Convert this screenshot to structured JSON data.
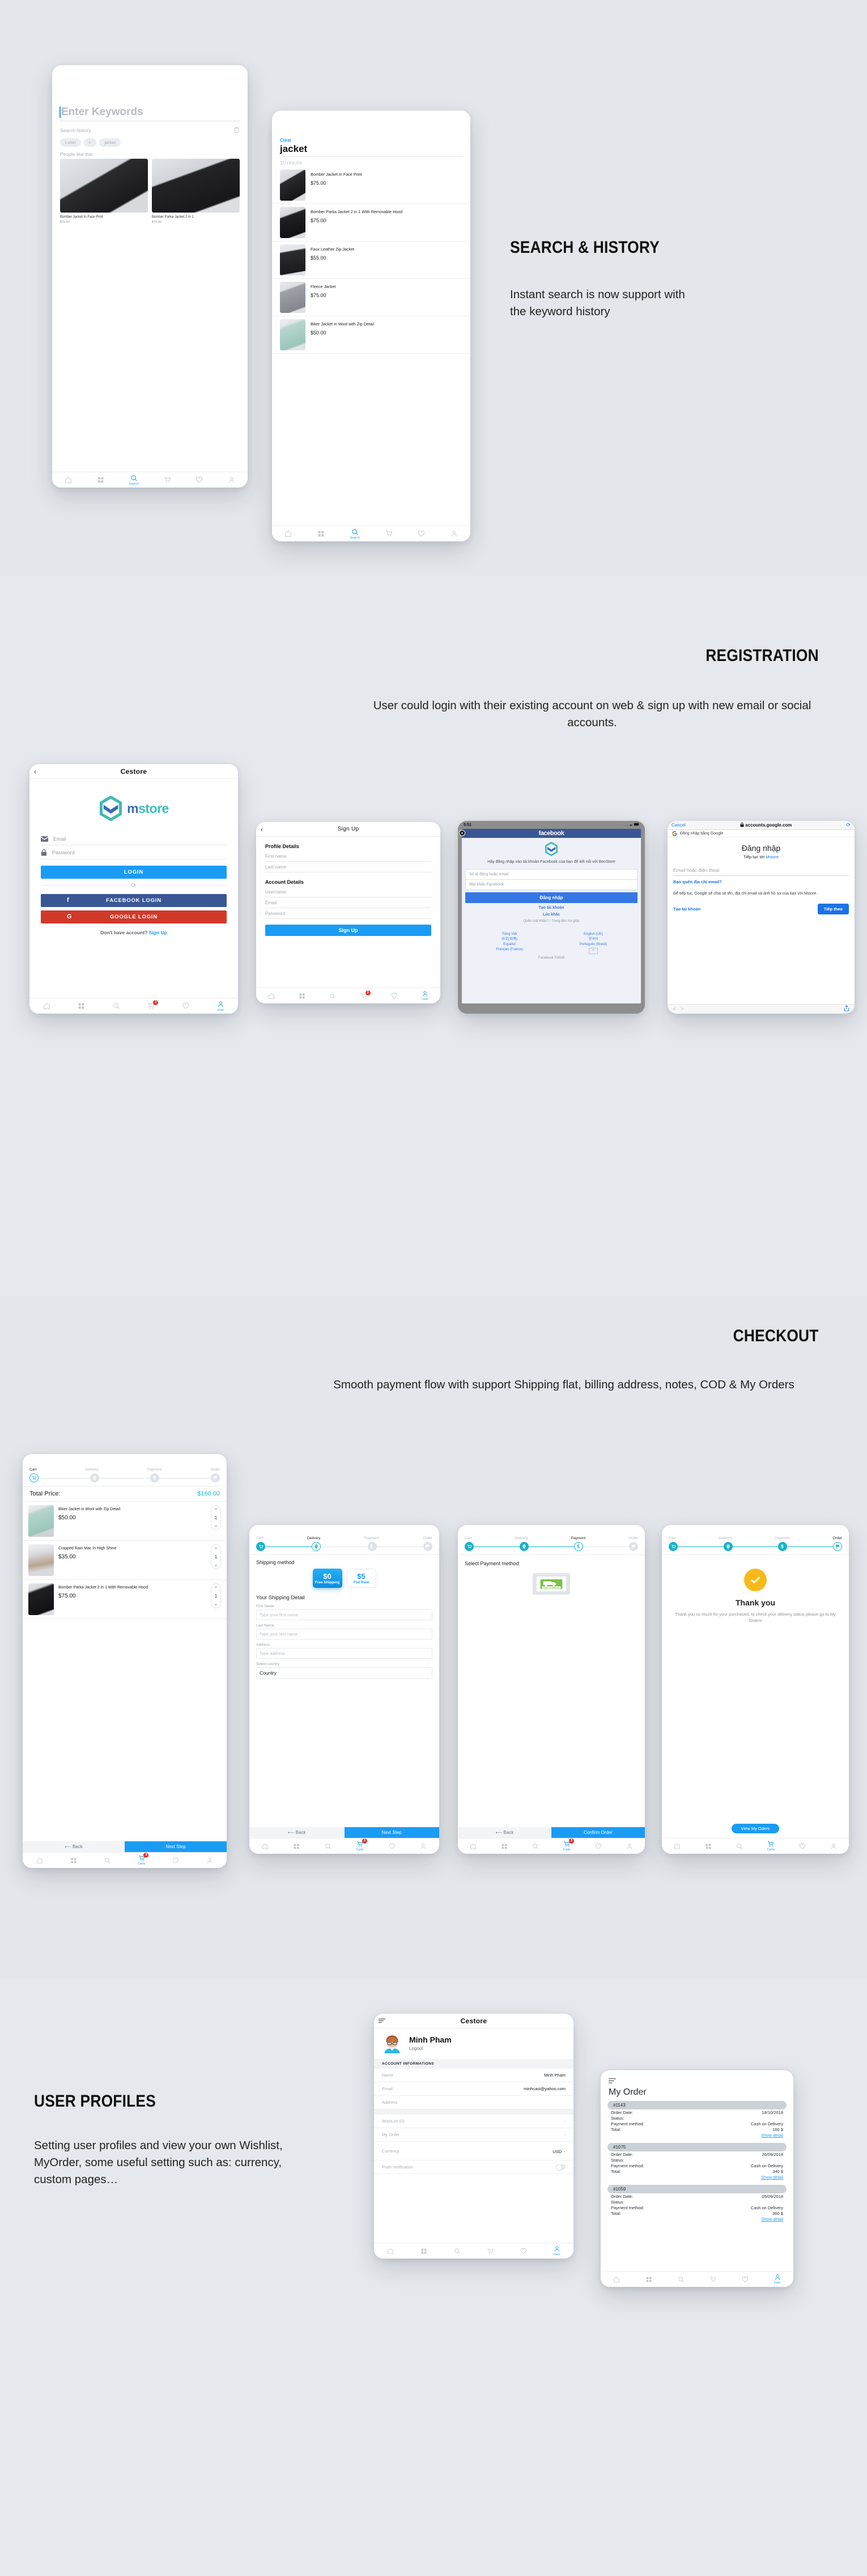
{
  "sections": {
    "search": {
      "title": "SEARCH & HISTORY",
      "body": "Instant search is now support with the keyword history"
    },
    "registration": {
      "title": "REGISTRATION",
      "body": "User could login with their existing account on web & sign up with new email or social accounts."
    },
    "checkout": {
      "title": "CHECKOUT",
      "body": "Smooth payment flow with support  Shipping flat, billing address, notes, COD & My Orders"
    },
    "profiles": {
      "title": "USER PROFILES",
      "body": "Setting user profiles and view your own Wishlist, MyOrder, some useful setting such as: currency, custom pages…"
    }
  },
  "search_empty": {
    "placeholder": "Enter Keywords",
    "history_label": "Search history",
    "trash_icon": "trash-icon",
    "chips": [
      "t-shirt",
      "t-",
      "jacket"
    ],
    "people_label": "People like this",
    "products": [
      {
        "name": "Bomber Jacket In Face Print",
        "price": "$75.00"
      },
      {
        "name": "Bomber Parka Jacket 2 in 1",
        "price": "$75.00"
      }
    ],
    "tab_label": "Search"
  },
  "search_results": {
    "clear": "Clear",
    "query": "jacket",
    "count": "10 results",
    "items": [
      {
        "name": "Bomber Jacket In Face Print",
        "price": "$75.00"
      },
      {
        "name": "Bomber Parka Jacket 2 in 1 With Removable Hood",
        "price": "$75.00"
      },
      {
        "name": "Faux Leather Zip Jacket",
        "price": "$55.00"
      },
      {
        "name": "Fleece Jacket",
        "price": "$75.00"
      },
      {
        "name": "Biker Jacket in Wool with Zip Detail",
        "price": "$50.00"
      }
    ],
    "tab_label": "Search"
  },
  "login": {
    "nav_title": "Cestore",
    "back_icon": "chevron-left-icon",
    "brand": {
      "m": "m",
      "store": "store"
    },
    "email_placeholder": "Email",
    "password_placeholder": "Password",
    "login_button": "LOGIN",
    "or": "Or",
    "facebook_button": "FACEBOOK LOGIN",
    "google_button": "GOOGLE LOGIN",
    "no_account": "Don't have account?",
    "signup_link": "Sign Up",
    "cart_badge": "3",
    "user_tab_label": "User"
  },
  "signup": {
    "nav_title": "Sign Up",
    "profile_heading": "Profile Details",
    "first_name": "First name",
    "last_name": "Last name",
    "account_heading": "Account Details",
    "username": "Username",
    "email": "Email",
    "password": "Password",
    "submit": "Sign Up",
    "cart_badge": "3",
    "user_tab_label": "User"
  },
  "facebook": {
    "status_time": "5:51",
    "brand": "facebook",
    "close_icon": "close-icon",
    "desc": "Hãy đăng nhập vào tài khoản Facebook của bạn để kết nối với BeoStore",
    "email_placeholder": "Số di động hoặc email",
    "password_placeholder": "Mật khẩu Facebook",
    "login_button": "Đăng nhập",
    "create_account": "Tạo tài khoản",
    "other": "Lúc khác",
    "forgot": "Quên mật khẩu? - Trung tâm trợ giúp",
    "languages": [
      "Tiếng Việt",
      "English (UK)",
      "中文(台灣)",
      "한국어",
      "Español",
      "Português (Brasil)",
      "Français (France)",
      "+"
    ],
    "copyright": "Facebook ©2018"
  },
  "google": {
    "cancel": "Cancel",
    "url": "accounts.google.com",
    "lock_icon": "lock-icon",
    "reload_icon": "reload-icon",
    "subbar": "Đăng nhập bằng Google",
    "heading": "Đăng nhập",
    "subheading_prefix": "Tiếp tục tới ",
    "subheading_brand": "Mstore",
    "email_placeholder": "Email hoặc điện thoại",
    "forgot_email": "Bạn quên địa chỉ email?",
    "note": "Để tiếp tục, Google sẽ chia sẻ tên, địa chỉ email và ảnh hồ sơ của bạn với Mstore.",
    "create_account": "Tạo tài khoản",
    "next": "Tiếp theo",
    "share_icon": "share-icon"
  },
  "checkout_steps": {
    "labels": [
      "Cart",
      "Delivery",
      "Payment",
      "Order"
    ]
  },
  "cart": {
    "total_label": "Total Price:",
    "total_value": "$160.00",
    "items": [
      {
        "name": "Biker Jacket in Wool with Zip Detail",
        "price": "$50.00",
        "qty": "1"
      },
      {
        "name": "Cropped Rain Mac In High Shine",
        "price": "$35.00",
        "qty": "1"
      },
      {
        "name": "Bomber Parka Jacket 2 in 1 With Removable Hood",
        "price": "$75.00",
        "qty": "1"
      }
    ],
    "back": "Back",
    "next": "Next Step",
    "cart_badge": "3",
    "cart_tab_label": "Carts"
  },
  "delivery": {
    "shipping_method_label": "Shipping method",
    "options": [
      {
        "price": "$0",
        "name": "Free Shipping",
        "selected": true
      },
      {
        "price": "$5",
        "name": "Flat Rate",
        "selected": false
      }
    ],
    "detail_heading": "Your Shipping Detail",
    "fields": [
      {
        "label": "First Name",
        "placeholder": "Type your first name"
      },
      {
        "label": "Last Name",
        "placeholder": "Type your last name"
      },
      {
        "label": "Address",
        "placeholder": "Type address"
      }
    ],
    "country_label": "Select country",
    "country_value": "Country",
    "back": "Back",
    "next": "Next Step",
    "cart_badge": "3",
    "cart_tab_label": "Carts"
  },
  "payment": {
    "heading": "Select Payment method:",
    "method_name": "Cash on delivery",
    "back": "Back",
    "confirm": "Confirm Order",
    "cart_badge": "3",
    "cart_tab_label": "Carts"
  },
  "thankyou": {
    "check_icon": "check-icon",
    "heading": "Thank you",
    "body": "Thank you so much for your purchased, to check your delivery status please go to My Orders",
    "button": "View My Oders",
    "cart_tab_label": "Carts"
  },
  "profile": {
    "nav_title": "Cestore",
    "menu_icon": "hamburger-icon",
    "user_name": "Minh Pham",
    "logout": "Logout",
    "section_heading": "ACCOUNT INFORMATIONS",
    "rows": [
      {
        "key": "Name",
        "value": "Minh Pham"
      },
      {
        "key": "Email",
        "value": "minhcasi@yahoo.com"
      },
      {
        "key": "Address",
        "value": ""
      }
    ],
    "links": [
      {
        "key": "WishList (0)",
        "value": ""
      },
      {
        "key": "My Order",
        "value": ""
      },
      {
        "key": "Currency",
        "value": "USD"
      }
    ],
    "push_label": "Push notification",
    "user_tab_label": "User"
  },
  "my_order": {
    "menu_icon": "hamburger-icon",
    "heading": "My Order",
    "labels": {
      "date": "Order Date:",
      "status": "Status:",
      "payment": "Payment method:",
      "total": "Total:",
      "detail": "Show detail"
    },
    "orders": [
      {
        "id": "#1143",
        "date": "18/10/2018",
        "status": "",
        "payment": "Cash on Delivery",
        "total": "160 $"
      },
      {
        "id": "#1075",
        "date": "26/09/2018",
        "status": "",
        "payment": "Cash on Delivery",
        "total": "340 $"
      },
      {
        "id": "#1059",
        "date": "05/09/2018",
        "status": "",
        "payment": "Cash on Delivery",
        "total": "360 $"
      }
    ],
    "user_tab_label": "User"
  },
  "colors": {
    "accent": "#1a9cf5",
    "teal": "#16b3c8",
    "facebook": "#3a5795",
    "google_red": "#d1392b",
    "badge_red": "#e0342b",
    "yellow": "#f9b91b",
    "page_bg": "#e3e6ea"
  }
}
